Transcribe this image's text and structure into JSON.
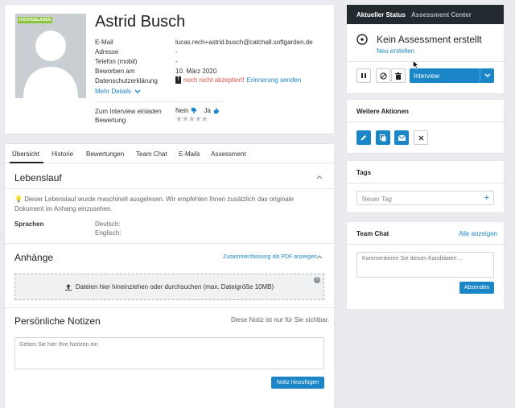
{
  "profile": {
    "badge": "HOCHGELADEN",
    "name": "Astrid Busch",
    "fields": [
      {
        "label": "E-Mail",
        "value": "lucas.rech+astrid.busch@catchall.softgarden.de"
      },
      {
        "label": "Adresse",
        "value": "-"
      },
      {
        "label": "Telefon (mobil)",
        "value": "-"
      },
      {
        "label": "Beworben am",
        "value": "10. März 2020"
      },
      {
        "label": "Datenschutzerklärung",
        "value": ""
      }
    ],
    "privacy_status": "noch nicht akzeptiert!",
    "privacy_reminder": "Erinnerung senden",
    "more_details": "Mehr Details",
    "invite_label": "Zum Interview einladen",
    "invite_no": "Nein",
    "invite_yes": "Ja",
    "rating_label": "Bewertung"
  },
  "tabs": [
    {
      "label": "Übersicht"
    },
    {
      "label": "Historie"
    },
    {
      "label": "Bewertungen"
    },
    {
      "label": "Team Chat"
    },
    {
      "label": "E-Mails"
    },
    {
      "label": "Assessment"
    }
  ],
  "cv": {
    "title": "Lebenslauf",
    "notice": "Dieser Lebenslauf wurde maschinell ausgelesen. Wir empfehlen Ihnen zusätzlich das originale Dokument im Anhang einzusehen.",
    "languages_label": "Sprachen",
    "lang1": "Deutsch:",
    "lang2": "Englisch:"
  },
  "attachments": {
    "title": "Anhänge",
    "summary_link": "Zusammenfassung als PDF anzeigen",
    "dropzone": "Dateien hier hineinziehen oder durchsuchen (max. Dateigröße 10MB)"
  },
  "notes": {
    "title": "Persönliche Notizen",
    "visibility": "Diese Notiz ist nur für Sie sichtbar.",
    "placeholder": "Geben Sie hier Ihre Notizen ein",
    "add_button": "Notiz hinzufügen"
  },
  "status": {
    "tab_active": "Aktueller Status",
    "tab_other": "Assessment Center",
    "heading": "Kein Assessment erstellt",
    "new_link": "Neu erstellen",
    "stage": "Interview"
  },
  "actions": {
    "title": "Weitere Aktionen"
  },
  "tags": {
    "title": "Tags",
    "placeholder": "Neuer Tag",
    "add": "+"
  },
  "team_chat": {
    "title": "Team Chat",
    "show_all": "Alle anzeigen",
    "placeholder": "Kommentieren Sie diesen Kandidaten ...",
    "send": "Absenden"
  },
  "colors": {
    "accent": "#1a86c7",
    "badge": "#8cc63f",
    "warning": "#d9534f",
    "dark_header": "#22292f"
  }
}
